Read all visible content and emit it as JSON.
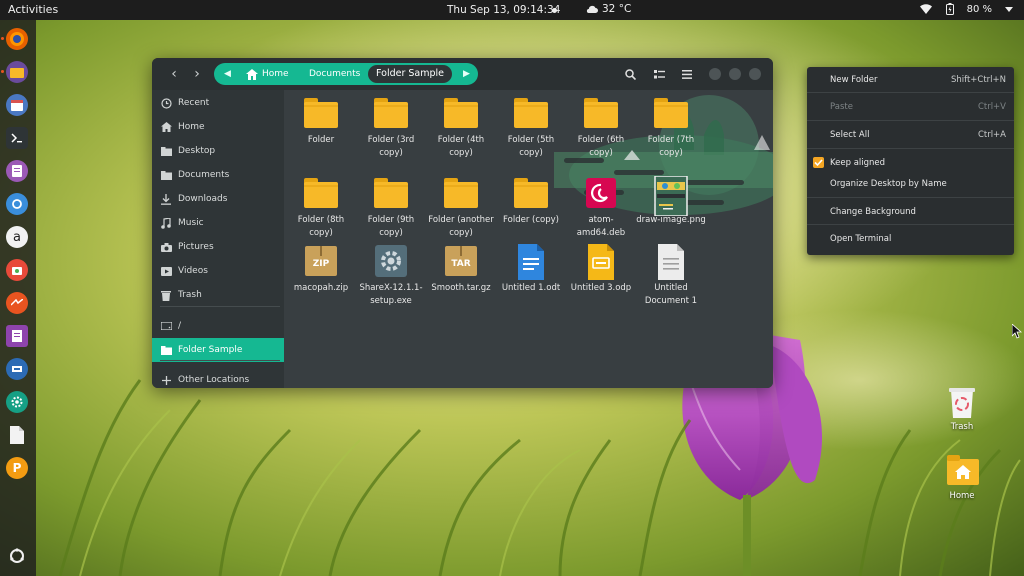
{
  "topbar": {
    "activities": "Activities",
    "clock": "Thu Sep 13, 09:14:34",
    "weather": "32 °C",
    "battery": "80 %"
  },
  "dock": {
    "items": [
      "firefox-icon",
      "files-icon",
      "calendar-icon",
      "terminal-icon",
      "document-viewer-icon",
      "sync-icon",
      "amazon-icon",
      "software-icon",
      "network-icon",
      "libreoffice-writer-icon",
      "synaptic-icon",
      "settings-icon",
      "text-file-icon",
      "poedit-icon"
    ],
    "bottom": "ubuntu-icon"
  },
  "file_manager": {
    "path": [
      "Home",
      "Documents",
      "Folder Sample"
    ],
    "sidebar": [
      {
        "label": "Recent",
        "icon": "clock-icon"
      },
      {
        "label": "Home",
        "icon": "home-icon"
      },
      {
        "label": "Desktop",
        "icon": "desktop-folder-icon"
      },
      {
        "label": "Documents",
        "icon": "documents-folder-icon"
      },
      {
        "label": "Downloads",
        "icon": "download-icon"
      },
      {
        "label": "Music",
        "icon": "music-icon"
      },
      {
        "label": "Pictures",
        "icon": "camera-icon"
      },
      {
        "label": "Videos",
        "icon": "video-icon"
      },
      {
        "label": "Trash",
        "icon": "trash-icon"
      },
      {
        "label": "/",
        "icon": "drive-icon"
      },
      {
        "label": "Folder Sample",
        "icon": "folder-icon"
      },
      {
        "label": "Other Locations",
        "icon": "plus-icon"
      }
    ],
    "files": [
      {
        "name": "Folder",
        "type": "folder"
      },
      {
        "name": "Folder (3rd copy)",
        "type": "folder"
      },
      {
        "name": "Folder (4th copy)",
        "type": "folder"
      },
      {
        "name": "Folder (5th copy)",
        "type": "folder"
      },
      {
        "name": "Folder (6th copy)",
        "type": "folder"
      },
      {
        "name": "Folder (7th copy)",
        "type": "folder"
      },
      {
        "name": "Folder (8th copy)",
        "type": "folder"
      },
      {
        "name": "Folder (9th copy)",
        "type": "folder"
      },
      {
        "name": "Folder (another copy)",
        "type": "folder"
      },
      {
        "name": "Folder (copy)",
        "type": "folder"
      },
      {
        "name": "atom-amd64.deb",
        "type": "deb"
      },
      {
        "name": "draw-image.png",
        "type": "image"
      },
      {
        "name": "macopah.zip",
        "type": "zip",
        "badge": "ZIP"
      },
      {
        "name": "ShareX-12.1.1-setup.exe",
        "type": "exe"
      },
      {
        "name": "Smooth.tar.gz",
        "type": "tar",
        "badge": "TAR"
      },
      {
        "name": "Untitled 1.odt",
        "type": "odt"
      },
      {
        "name": "Untitled 3.odp",
        "type": "odp"
      },
      {
        "name": "Untitled Document 1",
        "type": "txt"
      }
    ]
  },
  "context_menu": {
    "items": [
      {
        "label": "New Folder",
        "accel": "Shift+Ctrl+N"
      },
      {
        "label": "Paste",
        "accel": "Ctrl+V",
        "disabled": true
      },
      {
        "label": "Select All",
        "accel": "Ctrl+A"
      },
      {
        "label": "Keep aligned",
        "checked": true
      },
      {
        "label": "Organize Desktop by Name"
      },
      {
        "label": "Change Background"
      },
      {
        "label": "Open Terminal"
      }
    ]
  },
  "desktop": {
    "trash": "Trash",
    "home": "Home"
  },
  "colors": {
    "accent": "#15b892",
    "folder": "#f7b928",
    "window_bg": "#383e41",
    "menu_bg": "#2a2e30"
  }
}
